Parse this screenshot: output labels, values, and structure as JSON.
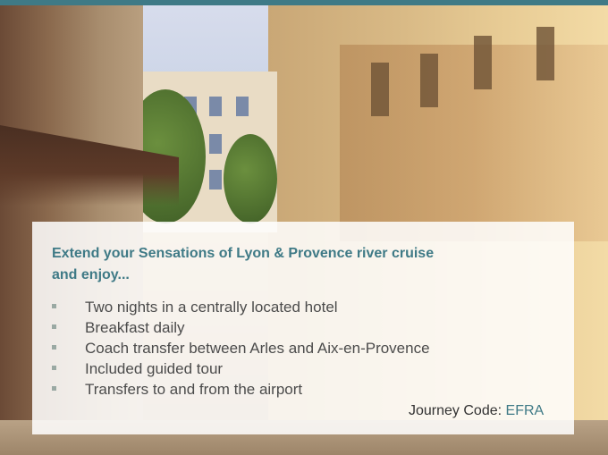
{
  "colors": {
    "accent_teal": "#3f7a86",
    "body_text": "#4b4b4b",
    "bullet": "#9aa9a3",
    "panel_bg": "rgba(255,255,255,0.86)"
  },
  "background_image": {
    "subject": "sunlit old-town street with pastel buildings, trees and awnings"
  },
  "offer": {
    "headline_line1": "Extend your Sensations of Lyon & Provence river cruise",
    "headline_line2": "and enjoy...",
    "features": [
      "Two nights in a centrally located hotel",
      "Breakfast daily",
      "Coach transfer between Arles and Aix-en-Provence",
      "Included guided tour",
      "Transfers to and from the airport"
    ],
    "journey_label": "Journey Code:",
    "journey_code": "EFRA"
  }
}
